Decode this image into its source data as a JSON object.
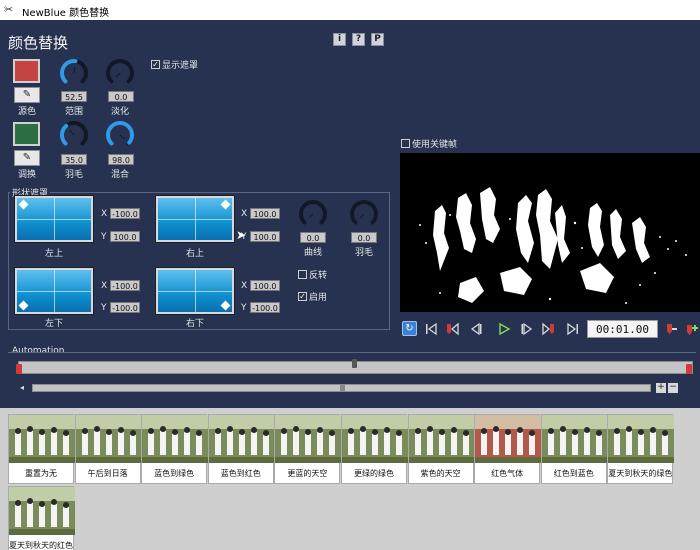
{
  "window": {
    "title": "NewBlue 颜色替换",
    "icon": "newblue-app-icon"
  },
  "panel": {
    "title": "颜色替换",
    "buttons": [
      {
        "label": "i",
        "name": "info"
      },
      {
        "label": "?",
        "name": "help"
      },
      {
        "label": "P",
        "name": "preset"
      }
    ],
    "show_mask": {
      "label": "显示遮罩",
      "checked": true
    }
  },
  "source_color": {
    "label": "源色",
    "color": "#c44444"
  },
  "replace_color": {
    "label": "调换",
    "color": "#2e6e44"
  },
  "knobs": {
    "range": {
      "label": "范围",
      "value": "52.5",
      "level": 0.525
    },
    "fade": {
      "label": "淡化",
      "value": "0.0",
      "level": 0.0
    },
    "feather": {
      "label": "羽毛",
      "value": "35.0",
      "level": 0.35
    },
    "blend": {
      "label": "混合",
      "value": "98.0",
      "level": 0.98
    },
    "curve": {
      "label": "曲线",
      "value": "0.0",
      "level": 0.0
    },
    "mask_feather": {
      "label": "羽毛",
      "value": "0.0",
      "level": 0.0
    }
  },
  "shape_mask": {
    "title": "形状遮罩",
    "top_left": {
      "label": "左上",
      "x": "-100.0",
      "y": "100.0"
    },
    "top_right": {
      "label": "右上",
      "x": "100.0",
      "y": "100.0"
    },
    "bottom_left": {
      "label": "左下",
      "x": "-100.0",
      "y": "-100.0"
    },
    "bottom_right": {
      "label": "右下",
      "x": "100.0",
      "y": "-100.0"
    },
    "x_label": "X",
    "y_label": "Y",
    "invert": {
      "label": "反转",
      "checked": false
    },
    "enable": {
      "label": "启用",
      "checked": true
    }
  },
  "keyframes": {
    "label": "使用关键帧",
    "checked": false
  },
  "transport": {
    "timecode": "00:01.00"
  },
  "automation": {
    "label": "Automation"
  },
  "presets": [
    {
      "name": "重置为无",
      "tint": "#7a8c5a"
    },
    {
      "name": "午后到日落",
      "tint": "#7a8c5a"
    },
    {
      "name": "蓝色到绿色",
      "tint": "#7a8c5a"
    },
    {
      "name": "蓝色到红色",
      "tint": "#7a8c5a"
    },
    {
      "name": "更蓝的天空",
      "tint": "#7a8c5a"
    },
    {
      "name": "更绿的绿色",
      "tint": "#7a8c5a"
    },
    {
      "name": "紫色的天空",
      "tint": "#7a8c5a"
    },
    {
      "name": "红色气体",
      "tint": "#b4584a"
    },
    {
      "name": "红色到蓝色",
      "tint": "#7a8c5a"
    },
    {
      "name": "夏天到秋天的绿色",
      "tint": "#7a8c5a"
    },
    {
      "name": "夏天到秋天的红色",
      "tint": "#7a8c5a"
    }
  ]
}
